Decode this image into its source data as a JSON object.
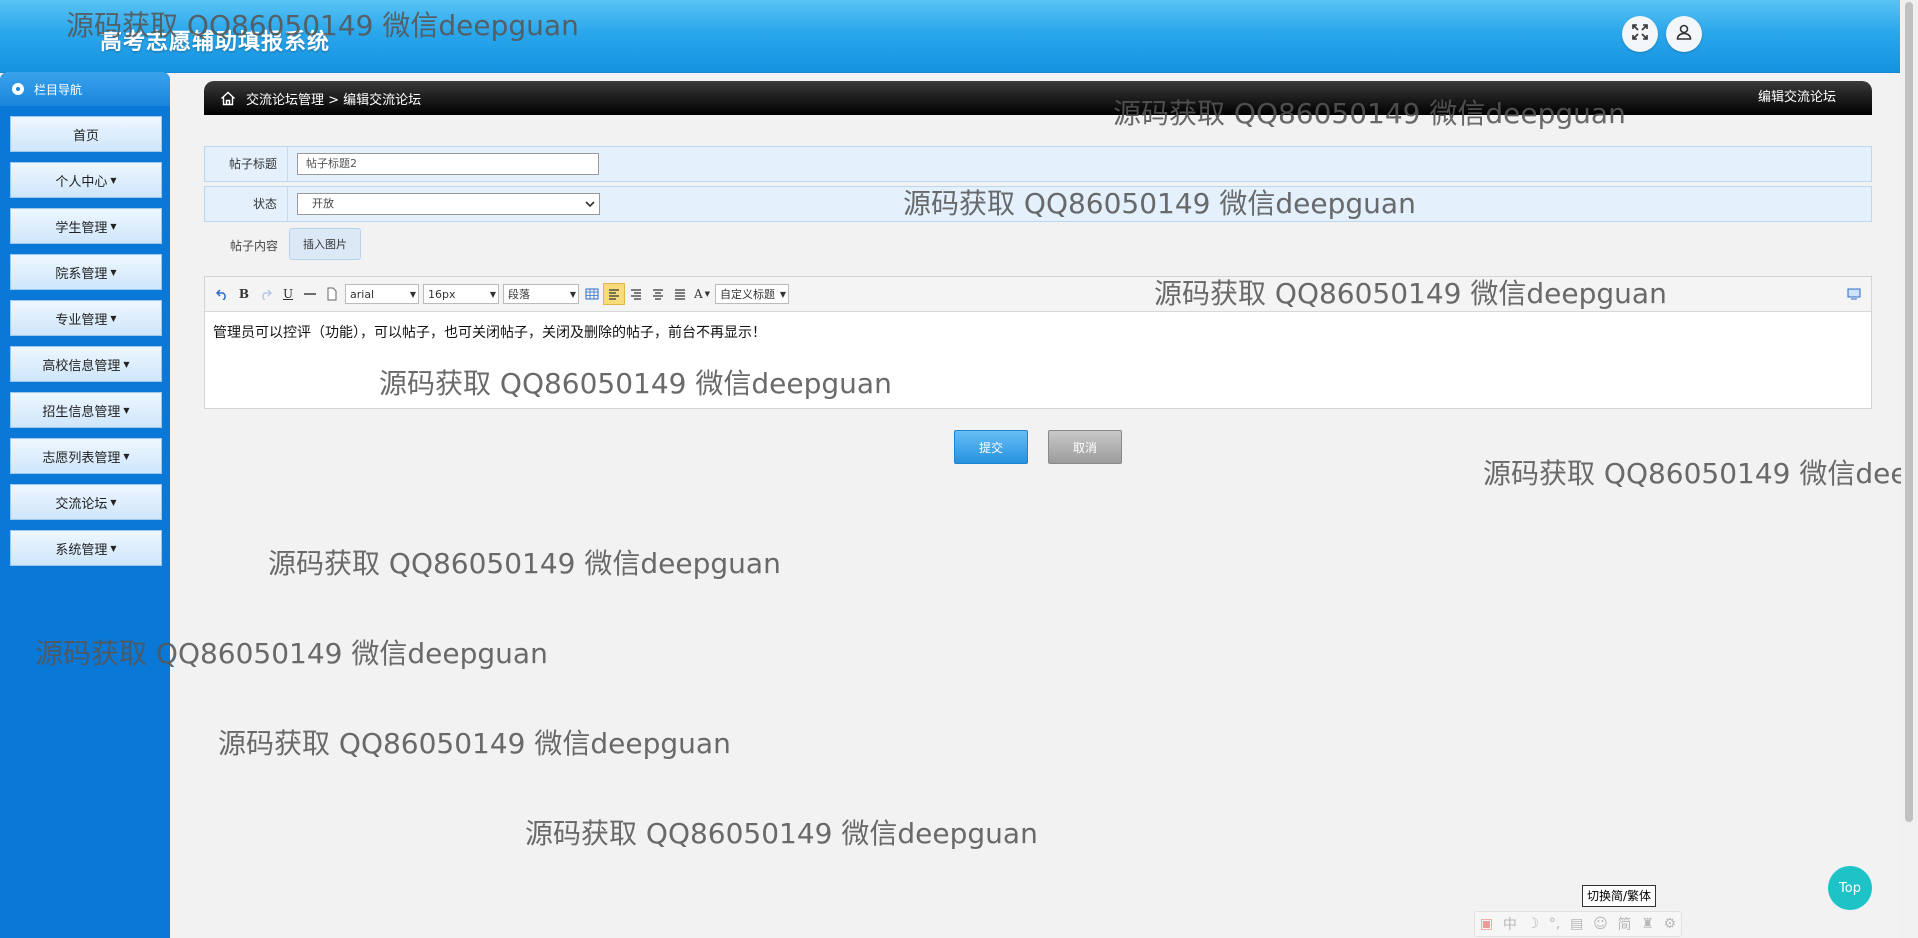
{
  "header": {
    "app_title": "高考志愿辅助填报系统"
  },
  "sidebar": {
    "title": "栏目导航",
    "items": [
      {
        "label": "首页",
        "has_caret": false
      },
      {
        "label": "个人中心",
        "has_caret": true
      },
      {
        "label": "学生管理",
        "has_caret": true
      },
      {
        "label": "院系管理",
        "has_caret": true
      },
      {
        "label": "专业管理",
        "has_caret": true
      },
      {
        "label": "高校信息管理",
        "has_caret": true
      },
      {
        "label": "招生信息管理",
        "has_caret": true
      },
      {
        "label": "志愿列表管理",
        "has_caret": true
      },
      {
        "label": "交流论坛",
        "has_caret": true
      },
      {
        "label": "系统管理",
        "has_caret": true
      }
    ]
  },
  "breadcrumb": {
    "path": "交流论坛管理 > 编辑交流论坛",
    "page_title": "编辑交流论坛"
  },
  "form": {
    "title_label": "帖子标题",
    "title_value": "帖子标题2",
    "status_label": "状态",
    "status_value": "开放",
    "content_label": "帖子内容",
    "insert_image_label": "插入图片"
  },
  "editor": {
    "font_family": "arial",
    "font_size": "16px",
    "paragraph": "段落",
    "custom_title": "自定义标题",
    "content": "管理员可以控评（功能），可以帖子，也可关闭帖子，关闭及删除的帖子，前台不再显示！"
  },
  "actions": {
    "submit_label": "提交",
    "cancel_label": "取消"
  },
  "watermark_text": "源码获取 QQ86050149 微信deepguan",
  "footer": {
    "switch_lang_label": "切换简/繁体",
    "top_label": "Top",
    "ime_items": [
      "中",
      "简"
    ]
  },
  "colors": {
    "header_blue": "#2aa7ec",
    "sidebar_blue": "#0a78d6",
    "submit_blue": "#2692e0",
    "top_teal": "#1ec3c8"
  }
}
